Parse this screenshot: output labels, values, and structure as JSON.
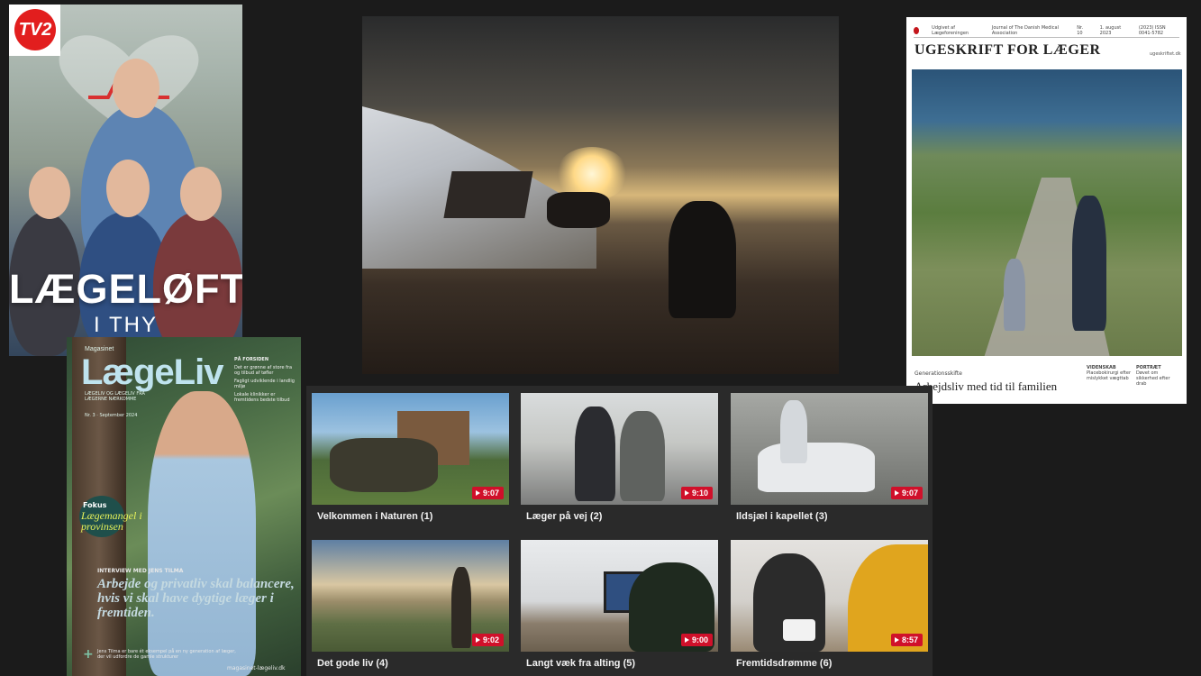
{
  "poster": {
    "logo_text": "TV2",
    "title": "LÆGELØFTET",
    "subtitle": "I THY"
  },
  "ugeskrift": {
    "topline": [
      "Udgivet af Lægeforeningen",
      "Journal of The Danish Medical Association",
      "Nr. 10",
      "1. august 2023",
      "(2023) ISSN 0041-5782"
    ],
    "masthead": "UGESKRIFT FOR LÆGER",
    "url": "ugeskriftet.dk",
    "kicker": "Generationsskifte",
    "headline": "Arbejdsliv med tid til familien",
    "side1_label": "VIDENSKAB",
    "side1_text": "Placebokirurgi efter mislykket vægttab",
    "side2_label": "PORTRÆT",
    "side2_text": "Døvet om sikkerhed efter drab"
  },
  "laegeliv": {
    "brand_small": "Magasinet",
    "brand": "LægeLiv",
    "tagline": "LÆGELIV OG LÆGELIV FRA LÆGERNE NÆRKOMME",
    "issue": "Nr. 3 · September 2024",
    "rightcol": [
      "PÅ FORSIDEN",
      "Det er grønne af store fra og tilbud af tøfler",
      "Fagligt udviklende i landlig miljø",
      "Lokale klinikker er fremtidens bedste tilbud"
    ],
    "fokus": "Fokus",
    "fokus_title": "Lægemangel i provinsen",
    "interview": "INTERVIEW MED JENS TILMA",
    "quote": "Arbejde og privatliv skal balancere, hvis vi skal have dygtige læger i fremtiden.",
    "blurb": "Jens Tilma er bare ét eksempel på en ny generation af læger, der vil udfordre de gamle strukturer",
    "site": "magasinet-lægeliv.dk"
  },
  "videos": [
    {
      "title": "Velkommen i Naturen (1)",
      "duration": "9:07"
    },
    {
      "title": "Læger på vej (2)",
      "duration": "9:10"
    },
    {
      "title": "Ildsjæl i kapellet (3)",
      "duration": "9:07"
    },
    {
      "title": "Det gode liv (4)",
      "duration": "9:02"
    },
    {
      "title": "Langt væk fra alting (5)",
      "duration": "9:00"
    },
    {
      "title": "Fremtidsdrømme (6)",
      "duration": "8:57"
    }
  ],
  "colors": {
    "background": "#1b1b1b",
    "duration_badge": "#d0102a",
    "tv2_red": "#e21e1e"
  }
}
